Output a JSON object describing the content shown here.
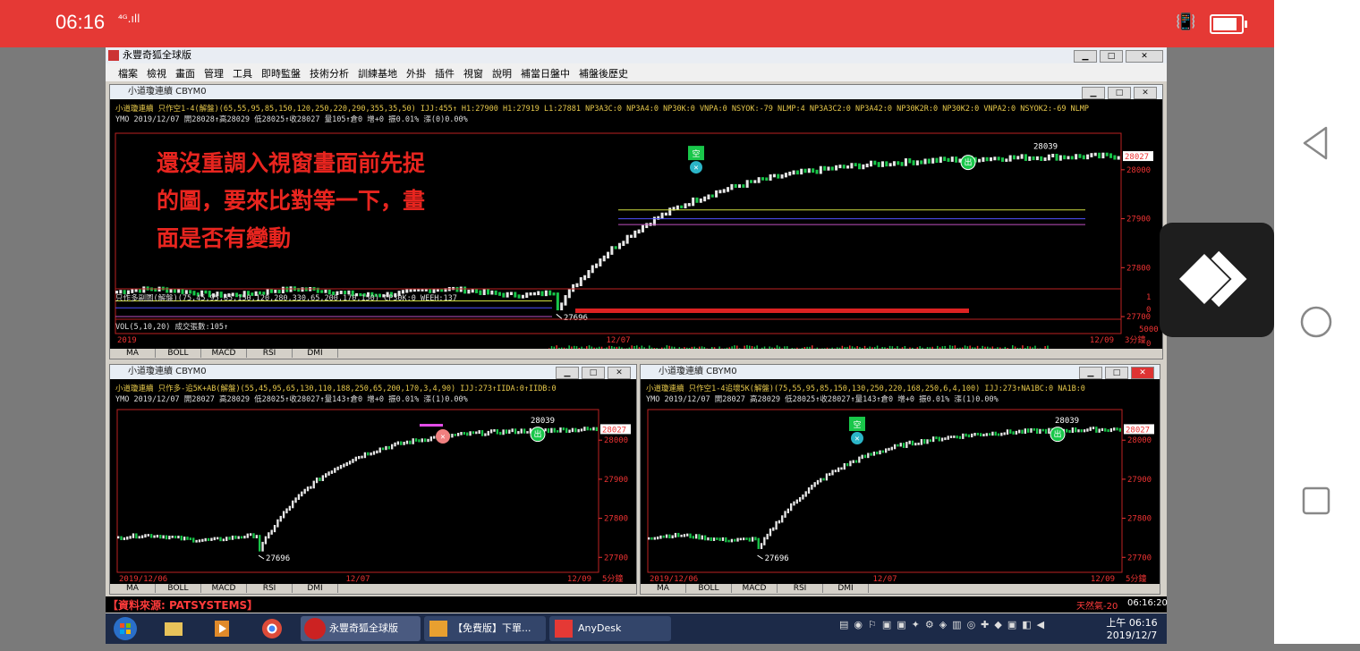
{
  "status_bar": {
    "time": "06:16",
    "signal": "⁴ᴳ.ıll"
  },
  "app": {
    "title": "永豐奇狐全球版",
    "menu": [
      "檔案",
      "檢視",
      "畫面",
      "管理",
      "工具",
      "即時監盤",
      "技術分析",
      "訓練基地",
      "外掛",
      "插件",
      "視窗",
      "說明",
      "補當日盤中",
      "補盤後歷史"
    ]
  },
  "panels": {
    "top": {
      "title": "小道瓊連續 CBYM0",
      "info1": "小道瓊連續 只作空1-4(解盤)(65,55,95,85,150,120,250,220,290,355,35,50) IJJ:455↑ H1:27900 H1:27919 L1:27881 NP3A3C:0 NP3A4:0 NP30K:0 VNPA:0 NSYOK:-79 NLMP:4 NP3A3C2:0 NP3A42:0 NP30K2R:0 NP30K2:0 VNPA2:0 NSYOK2:-69 NLMP",
      "info2": "YMO 2019/12/07 開28028↑高28029 低28025↑收28027 量105↑倉0 增+0 振0.01% 漲(0)0.00%",
      "sub_info": "只作多副圖(解盤)(75,45,95,65,150,120,280,330,65,200,170,150) CP30K:0 WEEH:137",
      "vol_info": "VOL(5,10,20) 成交張數:105↑",
      "price_tag": "28027",
      "high_label": "28039",
      "low_label": "27696",
      "y_ticks": [
        "28000",
        "27900",
        "27800",
        "27700"
      ],
      "sub_ticks": [
        "1",
        "0"
      ],
      "vol_ticks": [
        "5000",
        "0"
      ],
      "x_labels": [
        "2019",
        "12/07",
        "12/09"
      ],
      "period": "3分鐘",
      "signal_short": "空",
      "signal_exit": "出",
      "tabs": [
        "MA",
        "BOLL",
        "MACD",
        "RSI",
        "DMI"
      ]
    },
    "bottom_left": {
      "title": "小道瓊連續 CBYM0",
      "info1": "小道瓊連續 只作多-追5K+AB(解盤)(55,45,95,65,130,110,188,250,65,200,170,3,4,90) IJJ:273↑IIDA:0↑IIDB:0",
      "info2": "YMO 2019/12/07 開28027 高28029 低28025↑收28027↑量143↑倉0 增+0 振0.01% 漲(1)0.00%",
      "price_tag": "28027",
      "high_label": "28039",
      "low_label": "27696",
      "y_ticks": [
        "28000",
        "27900",
        "27800",
        "27700"
      ],
      "x_labels": [
        "2019/12/06",
        "12/07",
        "12/09"
      ],
      "period": "5分鐘",
      "signal_exit": "出",
      "tabs": [
        "MA",
        "BOLL",
        "MACD",
        "RSI",
        "DMI"
      ]
    },
    "bottom_right": {
      "title": "小道瓊連續 CBYM0",
      "info1": "小道瓊連續 只作空1-4追壞5K(解盤)(75,55,95,85,150,130,250,220,168,250,6,4,100) IJJ:273↑NA1BC:0 NA1B:0",
      "info2": "YMO 2019/12/07 開28027 高28029 低28025↑收28027↑量143↑倉0 增+0 振0.01% 漲(1)0.00%",
      "price_tag": "28027",
      "high_label": "28039",
      "low_label": "27696",
      "y_ticks": [
        "28000",
        "27900",
        "27800",
        "27700"
      ],
      "x_labels": [
        "2019/12/06",
        "12/07",
        "12/09"
      ],
      "period": "5分鐘",
      "signal_short": "空",
      "signal_exit": "出",
      "tabs": [
        "MA",
        "BOLL",
        "MACD",
        "RSI",
        "DMI"
      ]
    }
  },
  "overlay_note": "還沒重調入視窗畫面前先捉的圖，要來比對等一下，畫面是否有變動",
  "footer": {
    "source": "【資料來源: PATSYSTEMS】",
    "weather": "天然氣-20",
    "clock": "06:16:20"
  },
  "taskbar": {
    "items": [
      "永豐奇狐全球版",
      "【免費版】下單...",
      "AnyDesk"
    ],
    "time": "上午 06:16",
    "date": "2019/12/7"
  },
  "colors": {
    "status_red": "#e53935",
    "chart_bg": "#000000",
    "price_red": "#e33333",
    "candle_green": "#19c74a",
    "note_red": "#e8251f"
  }
}
